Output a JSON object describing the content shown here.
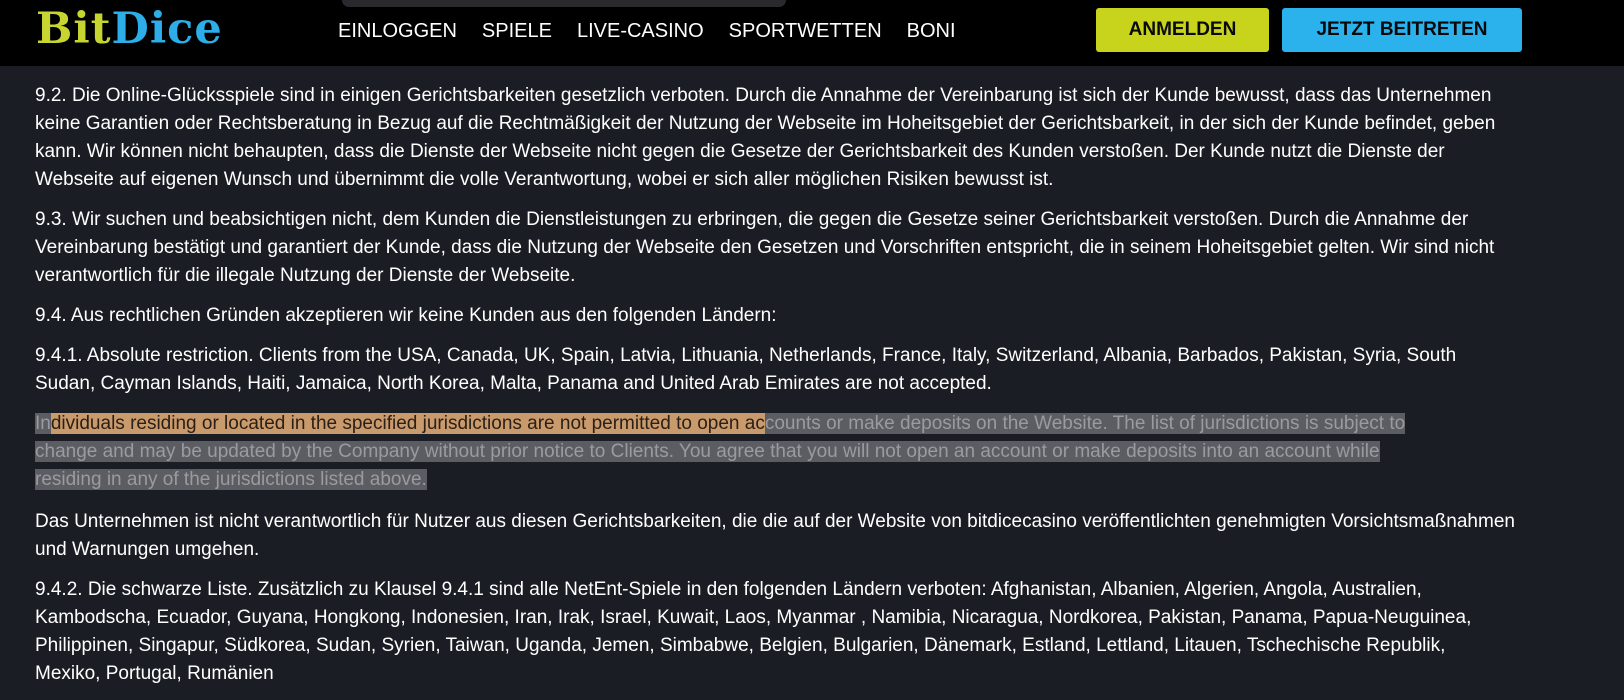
{
  "header": {
    "logo_part1": "Bit",
    "logo_part2": "Dice",
    "nav": [
      "EINLOGGEN",
      "SPIELE",
      "LIVE-CASINO",
      "SPORTWETTEN",
      "BONI"
    ],
    "login_label": "ANMELDEN",
    "join_label": "JETZT BEITRETEN",
    "colors": {
      "login": "#c8d41c",
      "join": "#2bb1ec"
    }
  },
  "content": {
    "p92": "9.2. Die Online-Glücksspiele sind in einigen Gerichtsbarkeiten gesetzlich verboten. Durch die Annahme der Vereinbarung ist sich der Kunde bewusst, dass das Unternehmen keine Garantien oder Rechtsberatung in Bezug auf die Rechtmäßigkeit der Nutzung der Webseite im Hoheitsgebiet der Gerichtsbarkeit, in der sich der Kunde befindet, geben kann. Wir können nicht behaupten, dass die Dienste der Webseite nicht gegen die Gesetze der Gerichtsbarkeit des Kunden verstoßen. Der Kunde nutzt die Dienste der Webseite auf eigenen Wunsch und übernimmt die volle Verantwortung, wobei er sich aller möglichen Risiken bewusst ist.",
    "p93": "9.3. Wir suchen und beabsichtigen nicht, dem Kunden die Dienstleistungen zu erbringen, die gegen die Gesetze seiner Gerichtsbarkeit verstoßen. Durch die Annahme der Vereinbarung bestätigt und garantiert der Kunde, dass die Nutzung der Webseite den Gesetzen und Vorschriften entspricht, die in seinem Hoheitsgebiet gelten. Wir sind nicht verantwortlich für die illegale Nutzung der Dienste der Webseite.",
    "p94": "9.4. Aus rechtlichen Gründen akzeptieren wir keine Kunden aus den folgenden Ländern:",
    "p941": "9.4.1. Absolute restriction. Clients from the USA, Canada, UK, Spain, Latvia, Lithuania, Netherlands, France, Italy, Switzerland, Albania, Barbados, Pakistan, Syria, South Sudan, Cayman Islands, Haiti, Jamaica, North Korea, Malta, Panama and United Arab Emirates are not accepted.",
    "sel_pre": " In",
    "sel_orange": "dividuals residing or located in the specified jurisdictions are not permitted to open ac",
    "sel_rest1": "counts or make deposits on the Website. The list of jurisdictions is subject to",
    "sel_line2": "change and may be updated by the Company without prior notice to Clients. You agree that you will not open an account or make deposits into an account while",
    "sel_line3": "residing in any of the jurisdictions listed above.",
    "p_company": " Das Unternehmen ist nicht verantwortlich für Nutzer aus diesen Gerichtsbarkeiten, die die auf der Website von bitdicecasino veröffentlichten genehmigten Vorsichtsmaßnahmen und Warnungen umgehen.",
    "p942": "9.4.2. Die schwarze Liste. Zusätzlich zu Klausel 9.4.1 sind alle NetEnt-Spiele in den folgenden Ländern verboten: Afghanistan, Albanien, Algerien, Angola, Australien, Kambodscha, Ecuador, Guyana, Hongkong, Indonesien, Iran, Irak, Israel, Kuwait, Laos, Myanmar , Namibia, Nicaragua, Nordkorea, Pakistan, Panama, Papua-Neuguinea, Philippinen, Singapur, Südkorea, Sudan, Syrien, Taiwan, Uganda, Jemen, Simbabwe, Belgien, Bulgarien, Dänemark, Estland, Lettland, Litauen, Tschechische Republik, Mexiko, Portugal, Rumänien"
  }
}
